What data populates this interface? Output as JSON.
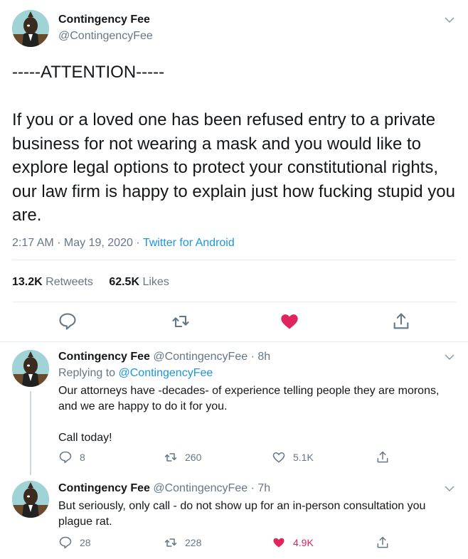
{
  "main": {
    "author_name": "Contingency Fee",
    "author_handle": "@ContingencyFee",
    "text": "-----ATTENTION-----\n\nIf you or a loved one has been refused entry to a private business for not wearing a mask and you would like to explore legal options to protect your constitutional rights, our law firm is happy to explain just how fucking stupid you are.",
    "time": "2:17 AM",
    "date": "May 19, 2020",
    "source": "Twitter for Android",
    "retweets_count": "13.2K",
    "retweets_label": "Retweets",
    "likes_count": "62.5K",
    "likes_label": "Likes",
    "liked": true
  },
  "replies": [
    {
      "author_name": "Contingency Fee",
      "author_handle": "@ContingencyFee",
      "age": "8h",
      "replying_label": "Replying to",
      "replying_handle": "@ContingencyFee",
      "text": "Our attorneys have -decades- of experience telling people they are morons, and we are happy to do it for you.\n\nCall today!",
      "reply_count": "8",
      "retweet_count": "260",
      "like_count": "5.1K",
      "liked": false
    },
    {
      "author_name": "Contingency Fee",
      "author_handle": "@ContingencyFee",
      "age": "7h",
      "text": "But seriously, only call - do not show up for an in-person consultation you plague rat.",
      "reply_count": "28",
      "retweet_count": "228",
      "like_count": "4.9K",
      "liked": true
    }
  ],
  "colors": {
    "accent": "#1b95e0",
    "like": "#e0245e",
    "muted": "#657786"
  }
}
